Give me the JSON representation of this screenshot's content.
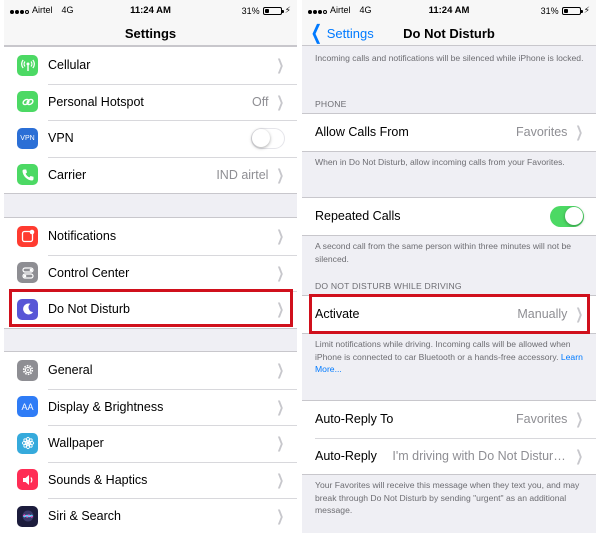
{
  "status_bar": {
    "carrier": "Airtel",
    "network": "4G",
    "time": "11:24 AM",
    "battery": "31%",
    "battery_level": 0.31
  },
  "left": {
    "title": "Settings",
    "group1": [
      {
        "label": "Cellular",
        "value": "",
        "icon": "antenna-icon",
        "color": "#4cd964",
        "control": "chevron"
      },
      {
        "label": "Personal Hotspot",
        "value": "Off",
        "icon": "hotspot-chain-icon",
        "color": "#4cd964",
        "control": "chevron"
      },
      {
        "label": "VPN",
        "value": "",
        "icon": "vpn-icon",
        "icon_text": "VPN",
        "color": "#2b6fd6",
        "control": "toggle-off"
      },
      {
        "label": "Carrier",
        "value": "IND airtel",
        "icon": "phone-icon",
        "color": "#4cd964",
        "control": "chevron"
      }
    ],
    "group2": [
      {
        "label": "Notifications",
        "value": "",
        "icon": "notifications-icon",
        "color": "#ff3b30",
        "control": "chevron"
      },
      {
        "label": "Control Center",
        "value": "",
        "icon": "control-center-icon",
        "color": "#8e8e93",
        "control": "chevron"
      },
      {
        "label": "Do Not Disturb",
        "value": "",
        "icon": "moon-icon",
        "color": "#5856d6",
        "control": "chevron"
      }
    ],
    "group3": [
      {
        "label": "General",
        "value": "",
        "icon": "gear-icon",
        "color": "#8e8e93",
        "control": "chevron"
      },
      {
        "label": "Display & Brightness",
        "value": "",
        "icon": "display-aa-icon",
        "icon_text": "AA",
        "color": "#2f7cf6",
        "control": "chevron"
      },
      {
        "label": "Wallpaper",
        "value": "",
        "icon": "wallpaper-flower-icon",
        "color": "#35aadc",
        "control": "chevron"
      },
      {
        "label": "Sounds & Haptics",
        "value": "",
        "icon": "speaker-icon",
        "color": "#ff2d55",
        "control": "chevron"
      },
      {
        "label": "Siri & Search",
        "value": "",
        "icon": "siri-icon",
        "color": "#1c1c3c",
        "control": "chevron"
      }
    ]
  },
  "right": {
    "back_label": "Settings",
    "title": "Do Not Disturb",
    "top_note": "Incoming calls and notifications will be silenced while iPhone is locked.",
    "phone_header": "PHONE",
    "allow_calls": {
      "label": "Allow Calls From",
      "value": "Favorites"
    },
    "allow_note": "When in Do Not Disturb, allow incoming calls from your Favorites.",
    "repeated_calls": {
      "label": "Repeated Calls",
      "on": true
    },
    "repeated_note": "A second call from the same person within three minutes will not be silenced.",
    "driving_header": "DO NOT DISTURB WHILE DRIVING",
    "activate": {
      "label": "Activate",
      "value": "Manually"
    },
    "activate_note": "Limit notifications while driving. Incoming calls will be allowed when iPhone is connected to car Bluetooth or a hands-free accessory.",
    "learn_more": "Learn More...",
    "auto_reply_to": {
      "label": "Auto-Reply To",
      "value": "Favorites"
    },
    "auto_reply": {
      "label": "Auto-Reply",
      "value": "I'm driving with Do Not Disturb..."
    },
    "reply_note": "Your Favorites will receive this message when they text you, and may break through Do Not Disturb by sending \"urgent\" as an additional message."
  },
  "colors": {
    "highlight": "#d0101c",
    "accent": "#007aff",
    "toggle_on": "#4cd964"
  }
}
